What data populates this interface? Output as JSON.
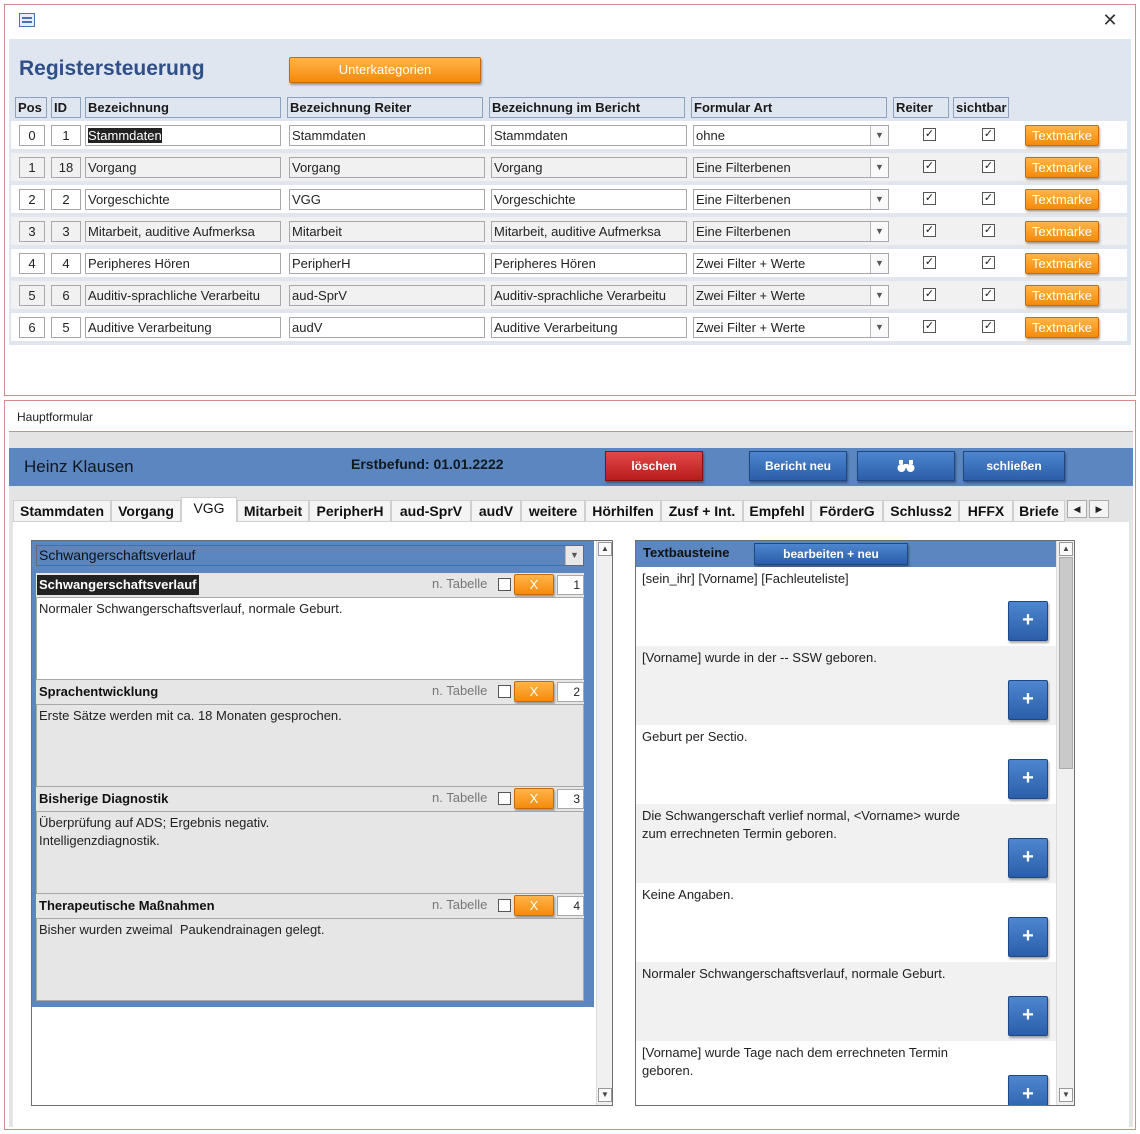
{
  "window1": {
    "close_icon": "close-icon",
    "form_title": "Registersteuerung",
    "unterkategorien_label": "Unterkategorien",
    "columns": [
      "Pos",
      "ID",
      "Bezeichnung",
      "Bezeichnung Reiter",
      "Bezeichnung im Bericht",
      "Formular Art",
      "Reiter",
      "sichtbar"
    ],
    "textmarke_label": "Textmarke",
    "rows": [
      {
        "pos": "0",
        "id": "1",
        "bezeichnung": "Stammdaten",
        "reiter": "Stammdaten",
        "bericht": "Stammdaten",
        "art": "ohne",
        "reiter_checked": true,
        "sichtbar_checked": true
      },
      {
        "pos": "1",
        "id": "18",
        "bezeichnung": "Vorgang",
        "reiter": "Vorgang",
        "bericht": "Vorgang",
        "art": "Eine Filterbenen",
        "reiter_checked": true,
        "sichtbar_checked": true
      },
      {
        "pos": "2",
        "id": "2",
        "bezeichnung": "Vorgeschichte",
        "reiter": "VGG",
        "bericht": "Vorgeschichte",
        "art": "Eine Filterbenen",
        "reiter_checked": true,
        "sichtbar_checked": true
      },
      {
        "pos": "3",
        "id": "3",
        "bezeichnung": "Mitarbeit, auditive Aufmerksa",
        "reiter": "Mitarbeit",
        "bericht": "Mitarbeit, auditive Aufmerksa",
        "art": "Eine Filterbenen",
        "reiter_checked": true,
        "sichtbar_checked": true
      },
      {
        "pos": "4",
        "id": "4",
        "bezeichnung": "Peripheres Hören",
        "reiter": "PeripherH",
        "bericht": "Peripheres Hören",
        "art": "Zwei Filter + Werte",
        "reiter_checked": true,
        "sichtbar_checked": true
      },
      {
        "pos": "5",
        "id": "6",
        "bezeichnung": "Auditiv-sprachliche Verarbeitu",
        "reiter": "aud-SprV",
        "bericht": "Auditiv-sprachliche Verarbeitu",
        "art": "Zwei Filter + Werte",
        "reiter_checked": true,
        "sichtbar_checked": true
      },
      {
        "pos": "6",
        "id": "5",
        "bezeichnung": "Auditive Verarbeitung",
        "reiter": "audV",
        "bericht": "Auditive Verarbeitung",
        "art": "Zwei Filter + Werte",
        "reiter_checked": true,
        "sichtbar_checked": true
      }
    ]
  },
  "window2": {
    "title": "Hauptformular",
    "client_name": "Heinz Klausen",
    "erstbefund": "Erstbefund:  01.01.2222",
    "btn_loeschen": "löschen",
    "btn_bericht_neu": "Bericht neu",
    "btn_suche_icon": "binoculars-icon",
    "btn_schliessen": "schließen",
    "tabs": [
      "Stammdaten",
      "Vorgang",
      "VGG",
      "Mitarbeit",
      "PeripherH",
      "aud-SprV",
      "audV",
      "weitere",
      "Hörhilfen",
      "Zusf + Int.",
      "Empfehl",
      "FörderG",
      "Schluss2",
      "HFFX",
      "Briefe"
    ],
    "active_tab": "VGG",
    "left_combo_value": "Schwangerschaftsverlauf",
    "n_tabelle_label": "n. Tabelle",
    "x_label": "X",
    "sections": [
      {
        "title": "Schwangerschaftsverlauf",
        "num": "1",
        "text": "Normaler Schwangerschaftsverlauf, normale Geburt."
      },
      {
        "title": "Sprachentwicklung",
        "num": "2",
        "text": "Erste Sätze werden mit ca. 18 Monaten gesprochen."
      },
      {
        "title": "Bisherige Diagnostik",
        "num": "3",
        "text": "Überprüfung auf ADS; Ergebnis negativ.\nIntelligenzdiagnostik."
      },
      {
        "title": "Therapeutische Maßnahmen",
        "num": "4",
        "text": "Bisher wurden zweimal  Paukendrainagen gelegt."
      }
    ],
    "textbausteine": {
      "title": "Textbausteine",
      "btn_bearbeiten": "bearbeiten + neu",
      "plus_label": "+",
      "items": [
        "[sein_ihr] [Vorname] [Fachleuteliste]",
        "[Vorname] wurde  in der -- SSW geboren.",
        "Geburt per Sectio.",
        "Die Schwangerschaft verlief normal, <Vorname> wurde zum errechneten Termin geboren.",
        "Keine Angaben.",
        "Normaler Schwangerschaftsverlauf, normale Geburt.",
        "[Vorname] wurde  Tage nach dem errechneten Termin geboren."
      ]
    }
  }
}
